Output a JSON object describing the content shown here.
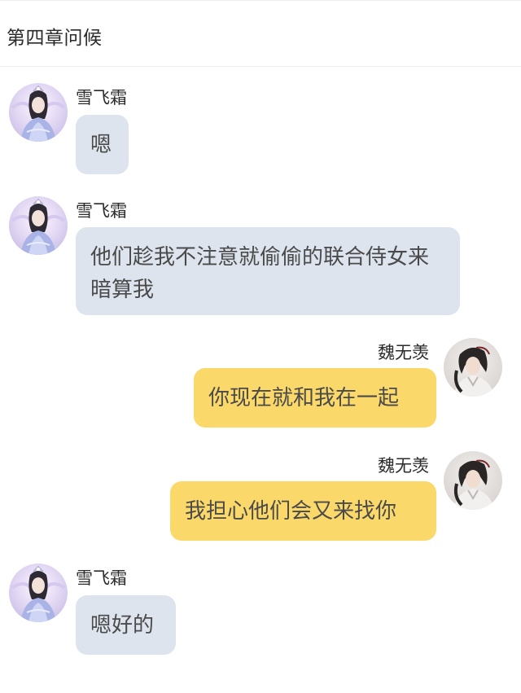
{
  "header": {
    "title": "第四章问候"
  },
  "messages": [
    {
      "sender": "雪飞霜",
      "side": "left",
      "text": "嗯"
    },
    {
      "sender": "雪飞霜",
      "side": "left",
      "text": "他们趁我不注意就偷偷的联合侍女来暗算我"
    },
    {
      "sender": "魏无羡",
      "side": "right",
      "text": "你现在就和我在一起"
    },
    {
      "sender": "魏无羡",
      "side": "right",
      "text": "我担心他们会又来找你"
    },
    {
      "sender": "雪飞霜",
      "side": "left",
      "text": "嗯好的"
    }
  ],
  "colors": {
    "left_bubble": "#dee4ee",
    "right_bubble": "#fbd86a",
    "background": "#ffffff"
  },
  "icons": {
    "left_avatar": "female-character-avatar",
    "right_avatar": "male-character-avatar"
  }
}
